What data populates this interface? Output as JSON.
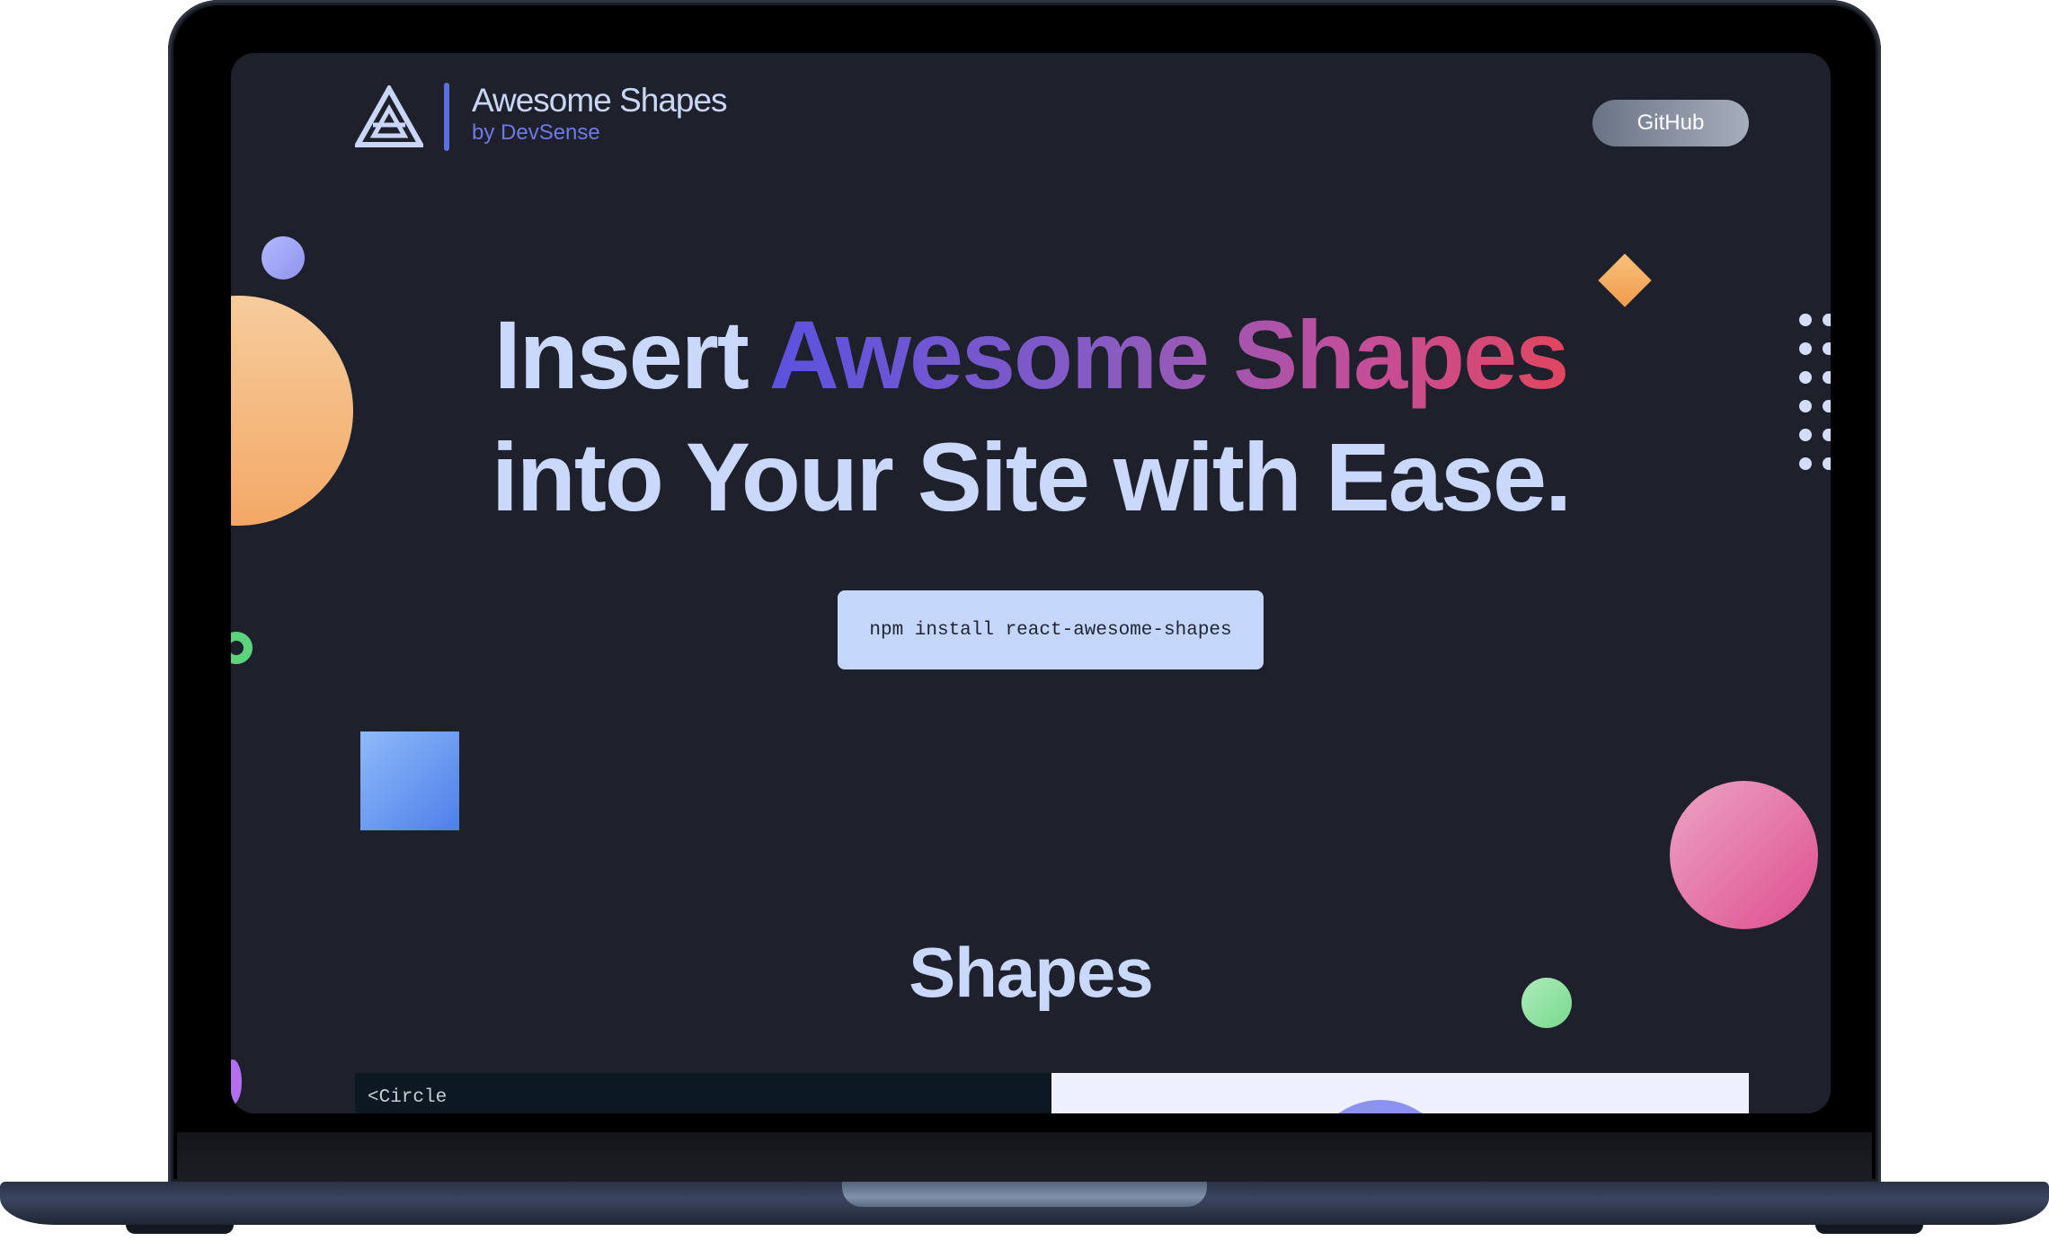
{
  "brand": {
    "name": "Awesome Shapes",
    "byline": "by DevSense"
  },
  "nav": {
    "github_label": "GitHub"
  },
  "hero": {
    "line1_plain": "Insert ",
    "line1_gradient": "Awesome Shapes",
    "line2": "into Your Site with Ease."
  },
  "install": {
    "command": "npm install react-awesome-shapes"
  },
  "shapes_section": {
    "title": "Shapes",
    "code_first_line": "<Circle"
  },
  "colors": {
    "background": "#1e212b",
    "text_primary": "#c9d8fb",
    "accent": "#5c6fe0",
    "gradient_start": "#5b52e0",
    "gradient_end": "#e0465f"
  },
  "icons": {
    "logo": "triangle-logo-icon"
  }
}
